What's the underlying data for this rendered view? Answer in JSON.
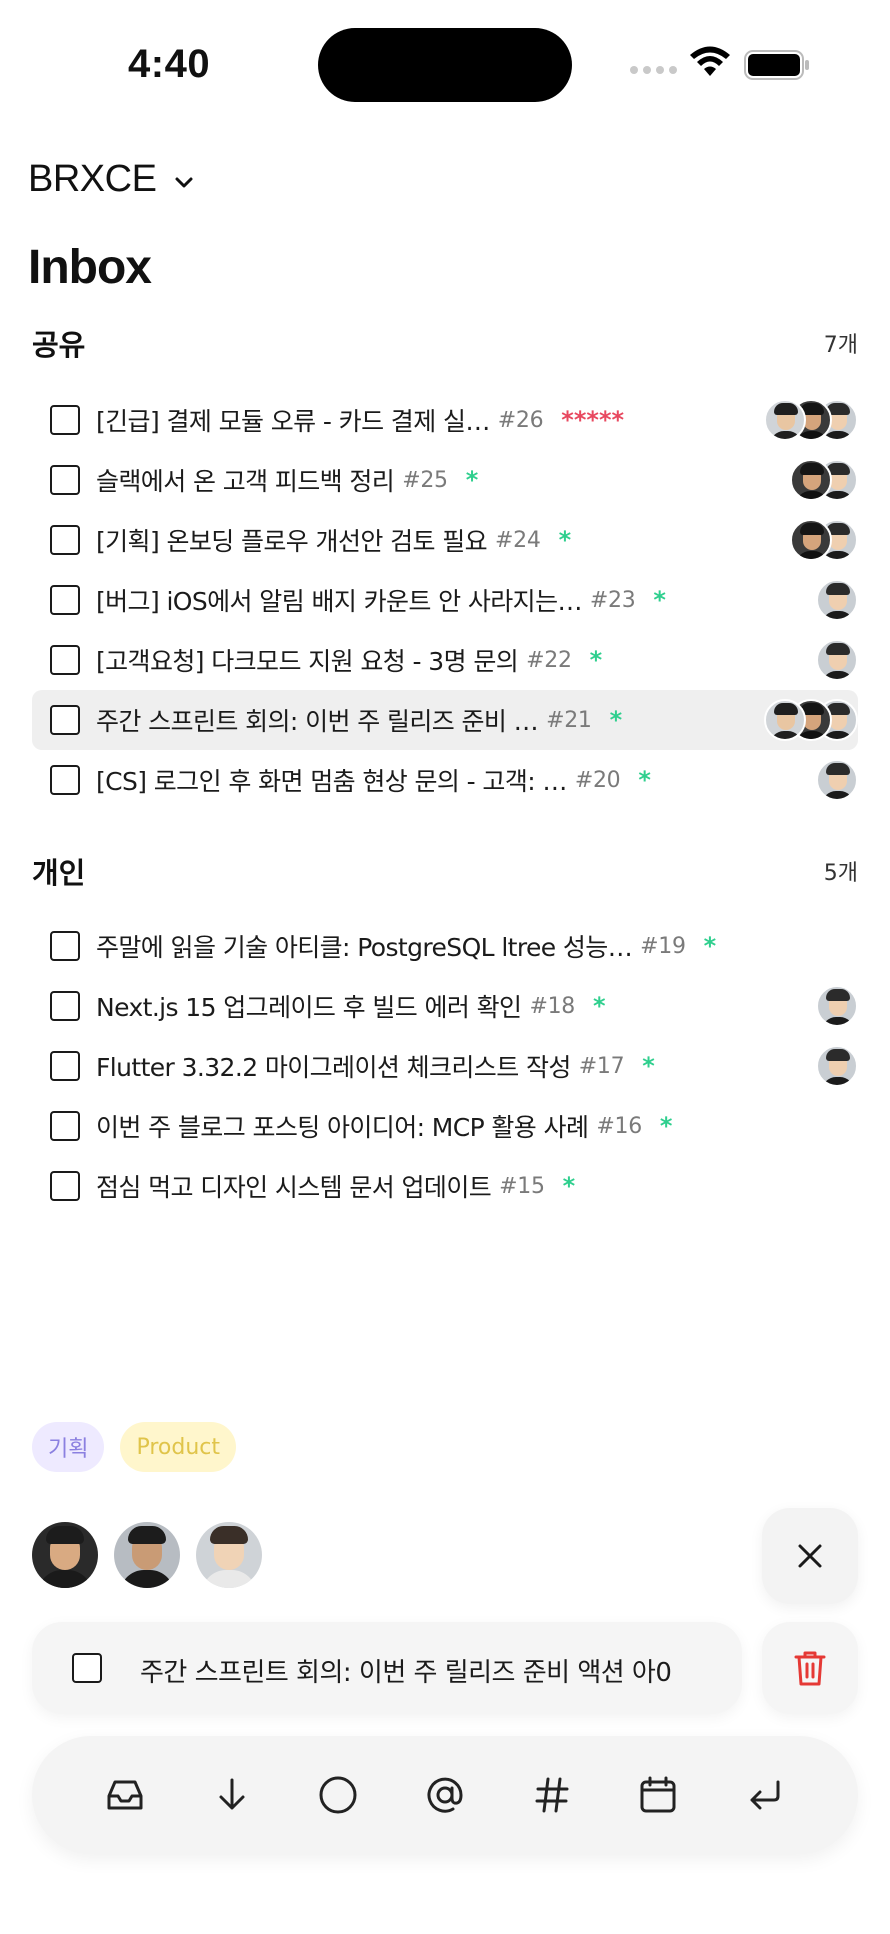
{
  "status_bar": {
    "time": "4:40"
  },
  "header": {
    "workspace": "BRXCE",
    "title": "Inbox"
  },
  "colors": {
    "priority_red": "#e8485f",
    "priority_green": "#2fcf8e",
    "delete_red": "#e53935"
  },
  "sections": [
    {
      "title": "공유",
      "count": "7개",
      "tasks": [
        {
          "title": "[긴급] 결제 모듈 오류 - 카드 결제 실…",
          "number": "#26",
          "priority": "*****",
          "priority_color": "#e8485f",
          "avatars": 3
        },
        {
          "title": "슬랙에서 온 고객 피드백 정리",
          "number": "#25",
          "priority": "*",
          "priority_color": "#2fcf8e",
          "avatars": 2
        },
        {
          "title": "[기획] 온보딩 플로우 개선안 검토 필요",
          "number": "#24",
          "priority": "*",
          "priority_color": "#2fcf8e",
          "avatars": 2
        },
        {
          "title": "[버그] iOS에서 알림 배지 카운트 안 사라지는…",
          "number": "#23",
          "priority": "*",
          "priority_color": "#2fcf8e",
          "avatars": 1
        },
        {
          "title": "[고객요청] 다크모드 지원 요청 - 3명 문의",
          "number": "#22",
          "priority": "*",
          "priority_color": "#2fcf8e",
          "avatars": 1
        },
        {
          "title": "주간 스프린트 회의: 이번 주 릴리즈 준비 …",
          "number": "#21",
          "priority": "*",
          "priority_color": "#2fcf8e",
          "avatars": 3,
          "highlight": true
        },
        {
          "title": "[CS] 로그인 후 화면 멈춤 현상 문의 - 고객: …",
          "number": "#20",
          "priority": "*",
          "priority_color": "#2fcf8e",
          "avatars": 1
        }
      ]
    },
    {
      "title": "개인",
      "count": "5개",
      "tasks": [
        {
          "title": "주말에 읽을 기술 아티클: PostgreSQL ltree 성능…",
          "number": "#19",
          "priority": "*",
          "priority_color": "#2fcf8e",
          "avatars": 0
        },
        {
          "title": "Next.js 15 업그레이드 후 빌드 에러 확인",
          "number": "#18",
          "priority": "*",
          "priority_color": "#2fcf8e",
          "avatars": 1
        },
        {
          "title": "Flutter 3.32.2 마이그레이션 체크리스트 작성",
          "number": "#17",
          "priority": "*",
          "priority_color": "#2fcf8e",
          "avatars": 1
        },
        {
          "title": "이번 주 블로그 포스팅 아이디어: MCP 활용 사례",
          "number": "#16",
          "priority": "*",
          "priority_color": "#2fcf8e",
          "avatars": 0
        },
        {
          "title": "점심 먹고 디자인 시스템 문서 업데이트",
          "number": "#15",
          "priority": "*",
          "priority_color": "#2fcf8e",
          "avatars": 0
        }
      ]
    }
  ],
  "editor": {
    "tags": [
      "기획",
      "Product"
    ],
    "draft_text": "주간 스프린트 회의: 이번 주 릴리즈 준비 액션 아0",
    "toolbar_icons": [
      "inbox-icon",
      "arrow-down-icon",
      "circle-icon",
      "at-icon",
      "hash-icon",
      "calendar-icon",
      "return-icon"
    ]
  }
}
